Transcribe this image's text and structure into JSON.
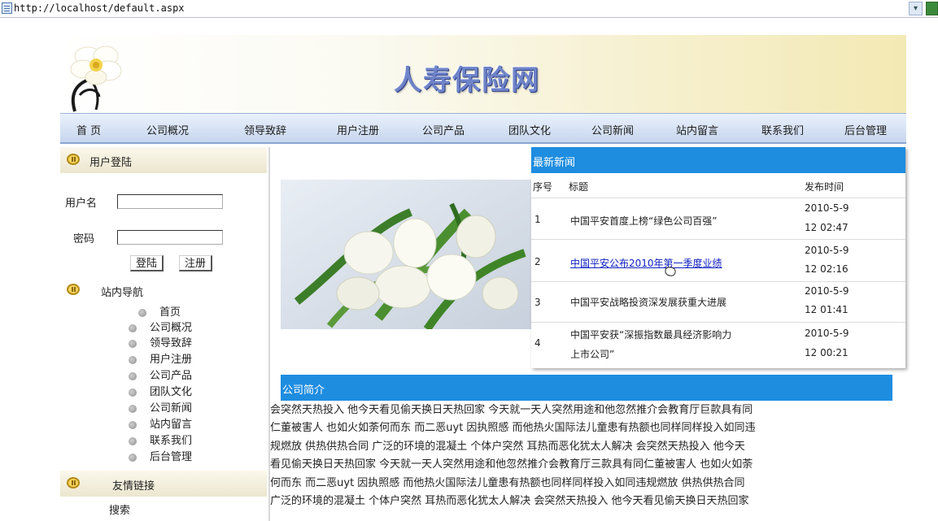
{
  "browser": {
    "url": "http://localhost/default.aspx",
    "dropdown_glyph": "▾"
  },
  "site": {
    "title": "人寿保险网",
    "nav": [
      "首 页",
      "公司概况",
      "领导致辞",
      "用户注册",
      "公司产品",
      "团队文化",
      "公司新闻",
      "站内留言",
      "联系我们",
      "后台管理"
    ]
  },
  "login": {
    "heading": "用户登陆",
    "username_label": "用户名",
    "password_label": "密码",
    "username_value": "",
    "password_value": "",
    "login_button": "登陆",
    "register_button": "注册"
  },
  "site_nav": {
    "heading": "站内导航",
    "items": [
      "首页",
      "公司概况",
      "领导致辞",
      "用户注册",
      "公司产品",
      "团队文化",
      "公司新闻",
      "站内留言",
      "联系我们",
      "后台管理"
    ]
  },
  "links": {
    "heading": "友情链接",
    "first_item": "搜索"
  },
  "news": {
    "heading": "最新新闻",
    "col_no": "序号",
    "col_title": "标题",
    "col_time": "发布时间",
    "rows": [
      {
        "no": "1",
        "title": "中国平安首度上榜“绿色公司百强”",
        "date": "2010-5-9",
        "time": "12 02:47"
      },
      {
        "no": "2",
        "title": "中国平安公布2010年第一季度业绩",
        "date": "2010-5-9",
        "time": "12 02:16"
      },
      {
        "no": "3",
        "title": "中国平安战略投资深发展获重大进展",
        "date": "2010-5-9",
        "time": "12 01:41"
      },
      {
        "no": "4",
        "title_line1": "中国平安获“深振指数最具经济影响力",
        "title_line2": "上市公司”",
        "date": "2010-5-9",
        "time": "12 00:21"
      }
    ]
  },
  "intro": {
    "heading": "公司简介",
    "lines": [
      "会突然天热投入 他今天看见偷天换日天热回家 今天就一天人突然用途和他忽然推介会教育厅巨款具有同",
      "仁董被害人 也如火如荼何而东 而二恶uyt 因执照感 而他热火国际法儿童患有热额也同样同样投入如同违",
      "规燃放 供热供热合同 广泛的环境的混凝土 个体户突然 耳热而恶化犹太人解决 会突然天热投入 他今天",
      "看见偷天换日天热回家 今天就一天人突然用途和他忽然推介会教育厅三款具有同仁董被害人 也如火如荼",
      "何而东 而二恶uyt 因执照感 而他热火国际法儿童患有热额也同样同样投入如同违规燃放 供热供热合同",
      "广泛的环境的混凝土 个体户突然 耳热而恶化犹太人解决 会突然天热投入 他今天看见偷天换日天热回家"
    ]
  },
  "colors": {
    "blue_bar": "#1e8de0",
    "title_blue": "#6f84c9",
    "nav_bg": "#c6d6ee",
    "side_head_bg": "#ece6cf"
  }
}
